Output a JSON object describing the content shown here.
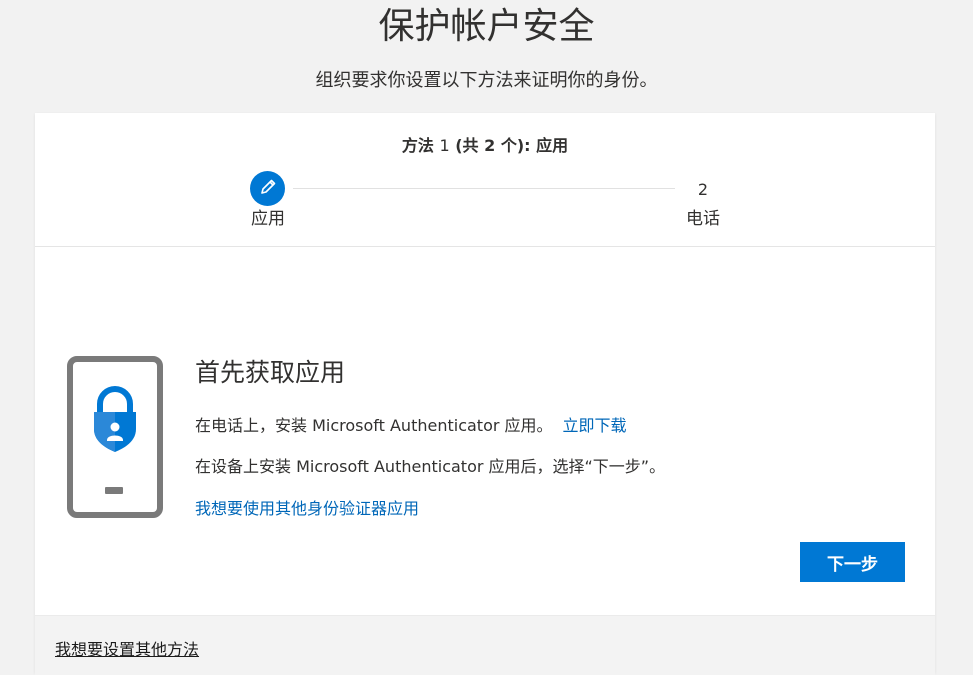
{
  "page": {
    "title": "保护帐户安全",
    "subtitle": "组织要求你设置以下方法来证明你的身份。"
  },
  "stepper": {
    "heading_prefix": "方法 ",
    "heading_current": "1",
    "heading_total_open": " (共 ",
    "heading_total": "2",
    "heading_total_close": " 个): ",
    "heading_method": "应用",
    "steps": [
      {
        "number": "1",
        "label": "应用",
        "state": "active",
        "icon": "pencil-icon"
      },
      {
        "number": "2",
        "label": "电话",
        "state": "pending"
      }
    ]
  },
  "content": {
    "title": "首先获取应用",
    "install_text": "在电话上，安装 Microsoft Authenticator 应用。",
    "download_link": "立即下载",
    "next_step_text": "在设备上安装 Microsoft Authenticator 应用后，选择“下一步”。",
    "other_authenticator_link": "我想要使用其他身份验证器应用",
    "illustration_icon": "authenticator-phone-icon"
  },
  "actions": {
    "next_button": "下一步"
  },
  "footer": {
    "other_method_link": "我想要设置其他方法"
  },
  "colors": {
    "accent": "#0078d4",
    "link": "#0067b8",
    "phone_frame": "#797979"
  }
}
